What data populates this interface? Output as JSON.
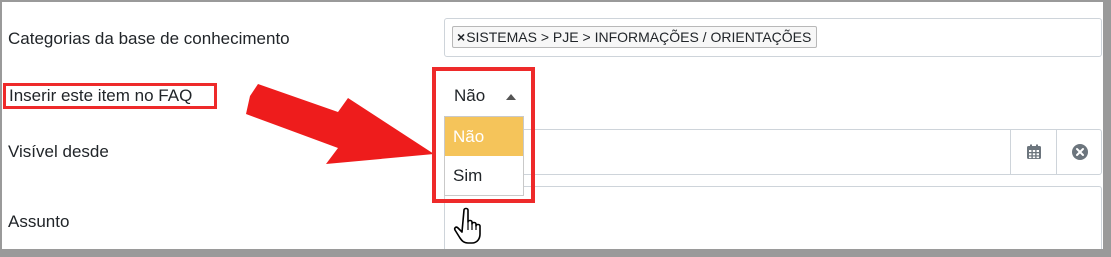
{
  "form": {
    "categories": {
      "label": "Categorias da base de conhecimento",
      "tag_remove": "×",
      "tag_text": "SISTEMAS > PJE > INFORMAÇÕES / ORIENTAÇÕES"
    },
    "faq": {
      "label": "Inserir este item no FAQ",
      "selected": "Não",
      "options": [
        "Não",
        "Sim"
      ],
      "highlighted_option": "Não"
    },
    "visible_since": {
      "label": "Visível desde",
      "calendar_icon": "calendar-icon",
      "clear_icon": "clear-icon"
    },
    "subject": {
      "label": "Assunto"
    }
  },
  "annotations": {
    "highlight_color": "#ee2a2a",
    "arrow_icon": "red-arrow",
    "cursor_icon": "hand-pointer-icon"
  },
  "colors": {
    "option_highlight": "#f5c45a",
    "border": "#ced4da"
  }
}
